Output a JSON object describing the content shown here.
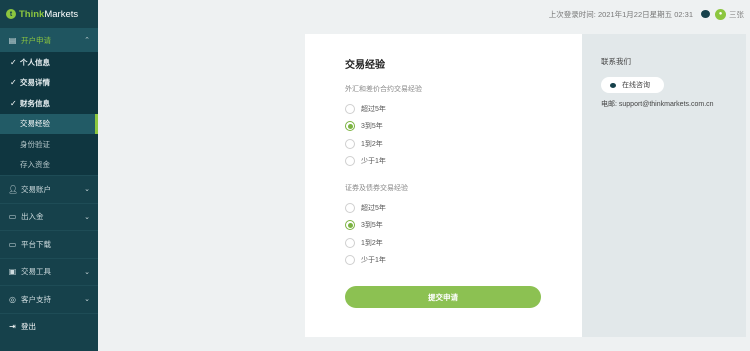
{
  "brand": {
    "name_prefix": "Think",
    "name_suffix": "Markets"
  },
  "topbar": {
    "last_login": "上次登录时间: 2021年1月22日星期五 02:31",
    "username": "三张"
  },
  "sidebar": {
    "open_section": "开户申请",
    "sub_items": [
      {
        "label": "个人信息",
        "state": "done"
      },
      {
        "label": "交易详情",
        "state": "done"
      },
      {
        "label": "财务信息",
        "state": "done"
      },
      {
        "label": "交易经验",
        "state": "active"
      },
      {
        "label": "身份验证",
        "state": "pending"
      },
      {
        "label": "存入资金",
        "state": "pending"
      }
    ],
    "items": [
      {
        "label": "交易账户",
        "has_chevron": true
      },
      {
        "label": "出入金",
        "has_chevron": true
      },
      {
        "label": "平台下载",
        "has_chevron": false
      },
      {
        "label": "交易工具",
        "has_chevron": true
      },
      {
        "label": "客户支持",
        "has_chevron": true
      },
      {
        "label": "登出",
        "has_chevron": false
      }
    ]
  },
  "form": {
    "title": "交易经验",
    "group1": {
      "label": "外汇和差价合约交易经验",
      "options": [
        "超过5年",
        "3到5年",
        "1到2年",
        "少于1年"
      ],
      "selected": 1
    },
    "group2": {
      "label": "证券及债券交易经验",
      "options": [
        "超过5年",
        "3到5年",
        "1到2年",
        "少于1年"
      ],
      "selected": 1
    },
    "submit_label": "提交申请"
  },
  "contact": {
    "title": "联系我们",
    "chat_label": "在线咨询",
    "email": "电邮: support@thinkmarkets.com.cn"
  },
  "colors": {
    "sidebar": "#16414b",
    "accent": "#8cc63f",
    "button": "#8cc152"
  }
}
